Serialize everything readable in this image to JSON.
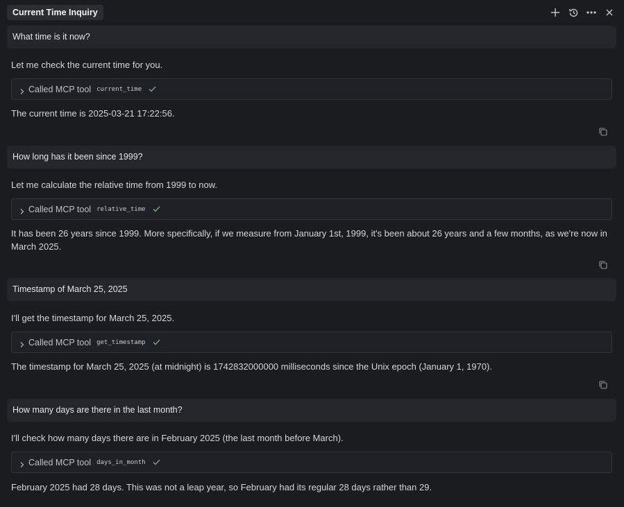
{
  "header": {
    "title": "Current Time Inquiry",
    "icons": [
      "plus-icon",
      "history-icon",
      "more-icon",
      "close-icon"
    ]
  },
  "conversation": [
    {
      "user": "What time is it now?",
      "intro": "Let me check the current time for you.",
      "tool_label": "Called MCP tool",
      "tool_name": "current_time",
      "answer": "The current time is 2025-03-21 17:22:56."
    },
    {
      "user": "How long has it been since 1999?",
      "intro": "Let me calculate the relative time from 1999 to now.",
      "tool_label": "Called MCP tool",
      "tool_name": "relative_time",
      "answer": "It has been 26 years since 1999. More specifically, if we measure from January 1st, 1999, it's been about 26 years and a few months, as we're now in March 2025."
    },
    {
      "user": "Timestamp of March 25, 2025",
      "intro": "I'll get the timestamp for March 25, 2025.",
      "tool_label": "Called MCP tool",
      "tool_name": "get_timestamp",
      "answer": "The timestamp for March 25, 2025 (at midnight) is 1742832000000 milliseconds since the Unix epoch (January 1, 1970)."
    },
    {
      "user": "How many days are there in the last month?",
      "intro": "I'll check how many days there are in February 2025 (the last month before March).",
      "tool_label": "Called MCP tool",
      "tool_name": "days_in_month",
      "answer": "February 2025 had 28 days. This was not a leap year, so February had its regular 28 days rather than 29."
    }
  ],
  "colors": {
    "background": "#1b1c20",
    "user_bubble": "#25262b",
    "tool_row": "#202126",
    "check": "#6fae7a"
  }
}
